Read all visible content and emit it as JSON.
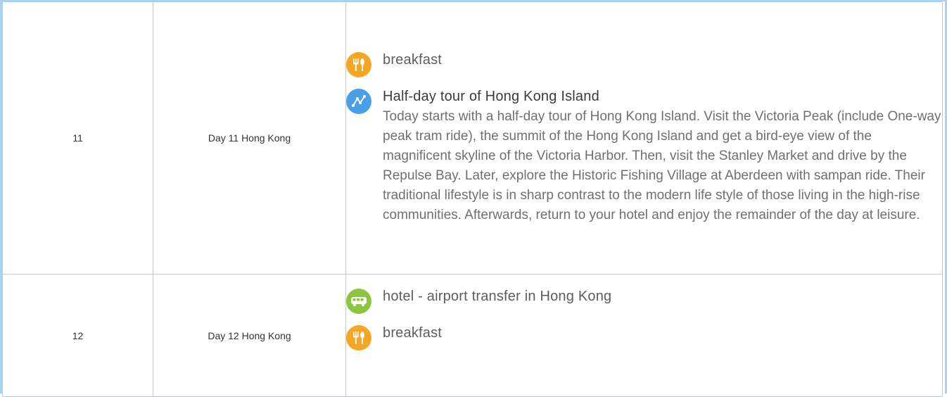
{
  "rows": [
    {
      "day": "11",
      "title": "Day 11 Hong Kong",
      "items": [
        {
          "icon": "meal-icon",
          "color": "#f5a623",
          "title": "breakfast"
        },
        {
          "icon": "tour-route-icon",
          "color": "#4a9fe6",
          "title": "Half-day tour of Hong Kong Island",
          "description": "Today starts with a half-day tour of Hong Kong Island. Visit the Victoria Peak (include One-way peak tram ride), the summit of the Hong Kong Island and get a bird-eye view of the magnificent skyline of the Victoria Harbor. Then, visit the Stanley Market and drive by the Repulse Bay. Later, explore the Historic Fishing Village at Aberdeen with sampan ride. Their traditional lifestyle is in sharp contrast to the modern life style of those living in the high-rise communities. Afterwards, return to your hotel and enjoy the remainder of the day at leisure."
        }
      ]
    },
    {
      "day": "12",
      "title": "Day 12 Hong Kong",
      "items": [
        {
          "icon": "bus-icon",
          "color": "#8cc63f",
          "title": "hotel - airport transfer in Hong Kong"
        },
        {
          "icon": "meal-icon",
          "color": "#f5a623",
          "title": "breakfast"
        }
      ]
    }
  ]
}
